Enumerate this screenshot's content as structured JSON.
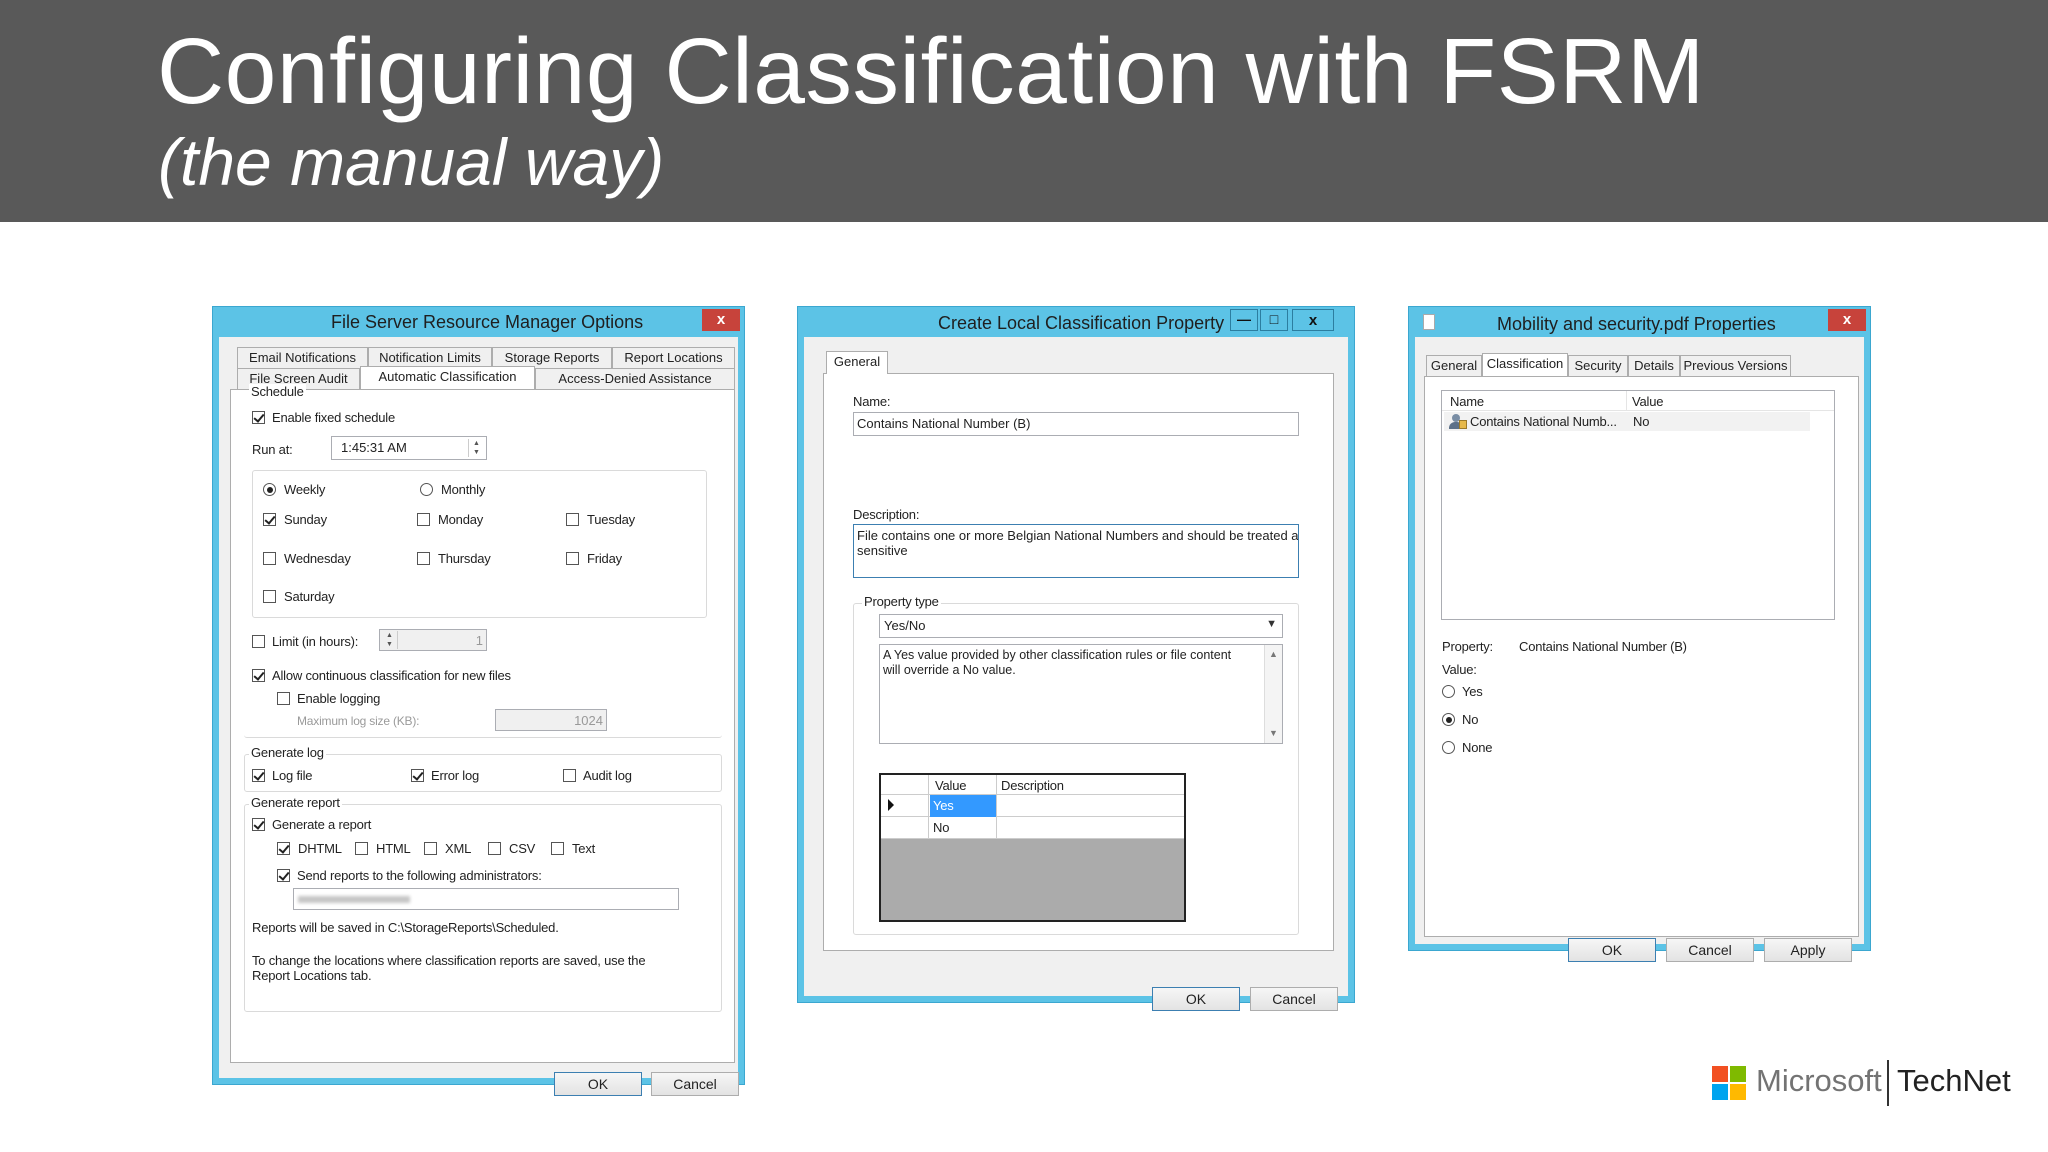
{
  "slide": {
    "title": "Configuring Classification with FSRM",
    "subtitle": "(the manual way)"
  },
  "win1": {
    "title": "File Server Resource Manager Options",
    "close": "x",
    "tabs_row1": [
      "Email Notifications",
      "Notification Limits",
      "Storage Reports",
      "Report Locations"
    ],
    "tabs_row2": [
      "File Screen Audit",
      "Automatic Classification",
      "Access-Denied Assistance"
    ],
    "schedule_label": "Schedule",
    "enable_fixed": "Enable fixed schedule",
    "run_at_label": "Run at:",
    "run_at_value": "1:45:31 AM",
    "weekly": "Weekly",
    "monthly": "Monthly",
    "days": [
      "Sunday",
      "Monday",
      "Tuesday",
      "Wednesday",
      "Thursday",
      "Friday",
      "Saturday"
    ],
    "limit_label": "Limit (in hours):",
    "limit_value": "1",
    "allow_continuous": "Allow continuous classification for new files",
    "enable_logging": "Enable logging",
    "max_log_label": "Maximum log size (KB):",
    "max_log_value": "1024",
    "generate_log_label": "Generate log",
    "log_file": "Log file",
    "error_log": "Error log",
    "audit_log": "Audit log",
    "generate_report_label": "Generate report",
    "generate_a_report": "Generate a report",
    "formats": [
      "DHTML",
      "HTML",
      "XML",
      "CSV",
      "Text"
    ],
    "send_reports": "Send reports to the following administrators:",
    "saved_in": "Reports will be saved in C:\\StorageReports\\Scheduled.",
    "change_locations_1": "To change the locations where classification reports are saved, use the",
    "change_locations_2": "Report Locations tab.",
    "ok": "OK",
    "cancel": "Cancel"
  },
  "win2": {
    "title": "Create Local Classification Property",
    "minimize": "—",
    "maximize": "□",
    "close": "x",
    "tab": "General",
    "name_label": "Name:",
    "name_value": "Contains National Number (B)",
    "desc_label": "Description:",
    "desc_line1": "File contains one or more Belgian National Numbers and should be treated as",
    "desc_line2": "sensitive",
    "property_type_label": "Property type",
    "property_type_value": "Yes/No",
    "type_info_1": "A Yes value provided by other classification rules or file content",
    "type_info_2": "will override a No value.",
    "grid_col_value": "Value",
    "grid_col_desc": "Description",
    "grid_row1": "Yes",
    "grid_row2": "No",
    "ok": "OK",
    "cancel": "Cancel"
  },
  "win3": {
    "title": "Mobility and security.pdf Properties",
    "close": "x",
    "tabs": [
      "General",
      "Classification",
      "Security",
      "Details",
      "Previous Versions"
    ],
    "col_name": "Name",
    "col_value": "Value",
    "row_name": "Contains National Numb...",
    "row_value": "No",
    "property_label": "Property:",
    "property_value": "Contains National Number (B)",
    "value_label": "Value:",
    "opt_yes": "Yes",
    "opt_no": "No",
    "opt_none": "None",
    "ok": "OK",
    "cancel": "Cancel",
    "apply": "Apply"
  },
  "logo": {
    "microsoft": "Microsoft",
    "technet": "TechNet",
    "colors": [
      "#f25022",
      "#7fba00",
      "#00a4ef",
      "#ffb900"
    ]
  }
}
